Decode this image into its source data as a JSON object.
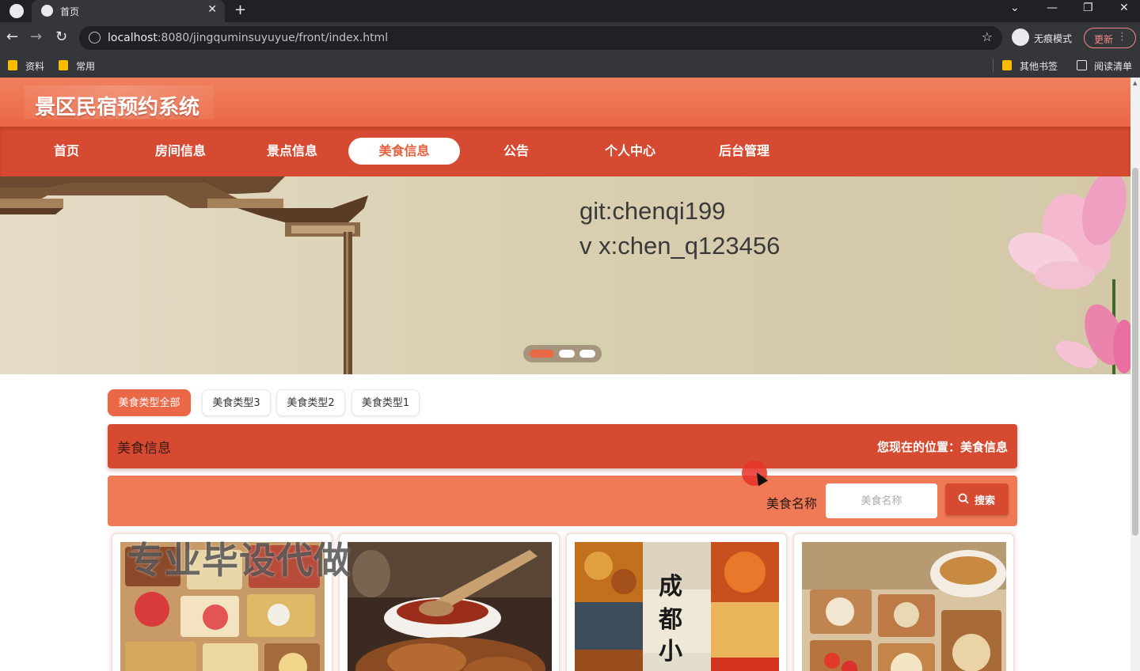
{
  "browser": {
    "tab_title": "首页",
    "url_host": "localhost",
    "url_rest": ":8080/jingquminsuyuyue/front/index.html",
    "incognito_label": "无痕模式",
    "update_label": "更新",
    "bookmarks": [
      {
        "label": "资料"
      },
      {
        "label": "常用"
      },
      {
        "label": "其他书签"
      },
      {
        "label": "阅读清单"
      }
    ]
  },
  "site": {
    "title": "景区民宿预约系统"
  },
  "nav": {
    "items": [
      {
        "label": "首页",
        "active": false
      },
      {
        "label": "房间信息",
        "active": false
      },
      {
        "label": "景点信息",
        "active": false
      },
      {
        "label": "美食信息",
        "active": true
      },
      {
        "label": "公告",
        "active": false
      },
      {
        "label": "个人中心",
        "active": false
      },
      {
        "label": "后台管理",
        "active": false
      }
    ]
  },
  "banner": {
    "line1": "git:chenqi199",
    "line2": "v x:chen_q123456",
    "slides_total": 3,
    "active_slide": 1
  },
  "categories": [
    {
      "label": "美食类型全部",
      "active": true
    },
    {
      "label": "美食类型3",
      "active": false
    },
    {
      "label": "美食类型2",
      "active": false
    },
    {
      "label": "美食类型1",
      "active": false
    }
  ],
  "section": {
    "title": "美食信息",
    "breadcrumb": "您现在的位置：美食信息"
  },
  "search": {
    "label": "美食名称",
    "placeholder": "美食名称",
    "button_label": "搜索"
  },
  "cards": [
    {
      "image": "bento-box-food-photo",
      "overlay_text": ""
    },
    {
      "image": "roast-meat-spoon-photo",
      "overlay_text": ""
    },
    {
      "image": "chengdu-snacks-collage-photo",
      "overlay_text": "成都小"
    },
    {
      "image": "dim-sum-tray-photo",
      "overlay_text": ""
    }
  ],
  "watermark": "专业毕设代做",
  "colors": {
    "brand": "#ea6846",
    "nav_bg": "#d64a31",
    "banner_bg": "#d9cfb2"
  }
}
